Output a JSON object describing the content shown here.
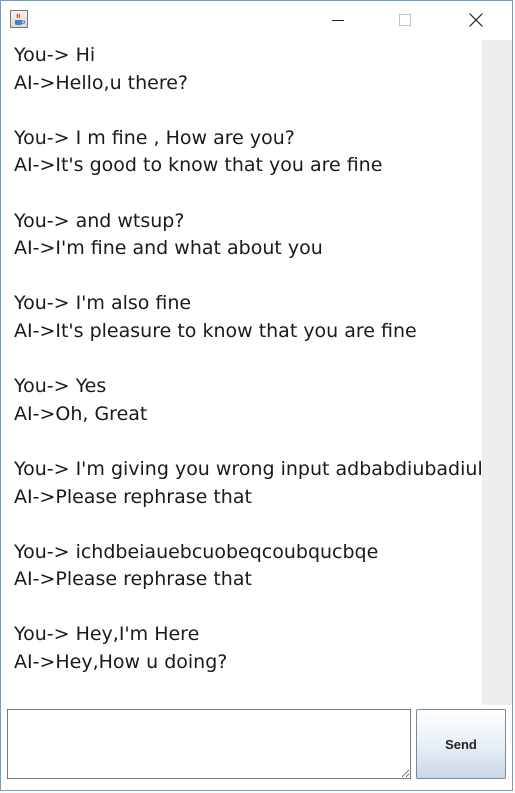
{
  "window": {
    "title": "",
    "icon": "java-cup-icon",
    "controls": {
      "minimize_icon": "minimize-icon",
      "maximize_icon": "maximize-icon",
      "close_icon": "close-icon"
    }
  },
  "chat": {
    "transcript": "You-> Hi\nAI->Hello,u there?\n\nYou-> I m fine , How are you?\nAI->It's good to know that you are fine\n\nYou-> and wtsup?\nAI->I'm fine and what about you\n\nYou-> I'm also fine\nAI->It's pleasure to know that you are fine\n\nYou-> Yes\nAI->Oh, Great\n\nYou-> I'm giving you wrong input adbabdiubadiubaduibaudi\nAI->Please rephrase that\n\nYou-> ichdbeiauebcuobeqcoubqucbqe\nAI->Please rephrase that\n\nYou-> Hey,I'm Here\nAI->Hey,How u doing?"
  },
  "input": {
    "value": "",
    "placeholder": ""
  },
  "send_button": {
    "label": "Send"
  },
  "colors": {
    "window_border": "#6e9fc9",
    "scroll_track": "#eeeeee",
    "text": "#1a1a1a"
  }
}
